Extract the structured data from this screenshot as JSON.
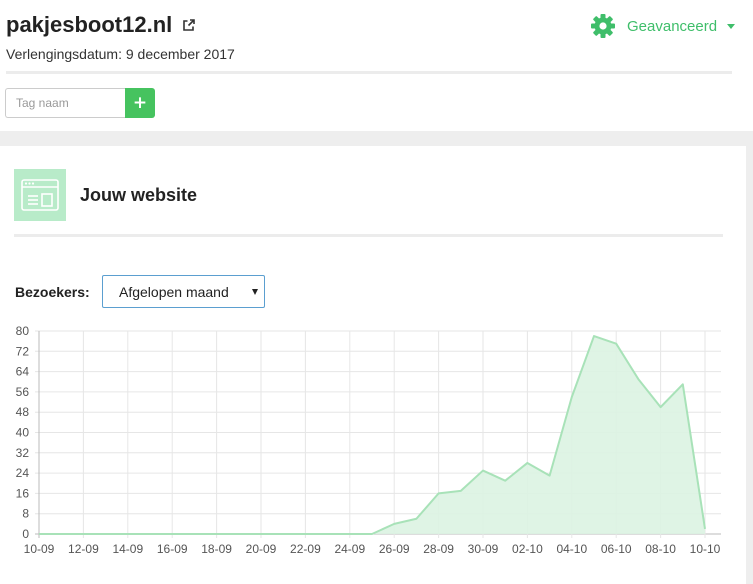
{
  "header": {
    "site_name": "pakjesboot12.nl",
    "renewal_text": "Verlengingsdatum: 9 december 2017",
    "advanced_label": "Geavanceerd",
    "tag_input_placeholder": "Tag naam",
    "add_tag_label": "+"
  },
  "card": {
    "title": "Jouw website",
    "visitors_label": "Bezoekers:",
    "period_selected": "Afgelopen maand"
  },
  "colors": {
    "accent": "#3fbe6a",
    "button": "#46c35f",
    "chart_line": "#a8e2b8",
    "chart_fill": "#dcf3e2"
  },
  "icons": {
    "external_link": "external-link-icon",
    "gear": "gear-icon",
    "website": "browser-window-icon",
    "plus": "plus-icon"
  },
  "chart_data": {
    "type": "area",
    "x": [
      "10-09",
      "11-09",
      "12-09",
      "13-09",
      "14-09",
      "15-09",
      "16-09",
      "17-09",
      "18-09",
      "19-09",
      "20-09",
      "21-09",
      "22-09",
      "23-09",
      "24-09",
      "25-09",
      "26-09",
      "27-09",
      "28-09",
      "29-09",
      "30-09",
      "01-10",
      "02-10",
      "03-10",
      "04-10",
      "05-10",
      "06-10",
      "07-10",
      "08-10",
      "09-10",
      "10-10"
    ],
    "x_tick_labels": [
      "10-09",
      "12-09",
      "14-09",
      "16-09",
      "18-09",
      "20-09",
      "22-09",
      "24-09",
      "26-09",
      "28-09",
      "30-09",
      "02-10",
      "04-10",
      "06-10",
      "08-10",
      "10-10"
    ],
    "values": [
      0,
      0,
      0,
      0,
      0,
      0,
      0,
      0,
      0,
      0,
      0,
      0,
      0,
      0,
      0,
      0,
      4,
      6,
      16,
      17,
      25,
      21,
      28,
      23,
      54,
      78,
      75,
      61,
      50,
      59,
      2
    ],
    "ylim": [
      0,
      80
    ],
    "y_ticks": [
      0,
      8,
      16,
      24,
      32,
      40,
      48,
      56,
      64,
      72,
      80
    ],
    "grid": true,
    "legend": "none"
  }
}
